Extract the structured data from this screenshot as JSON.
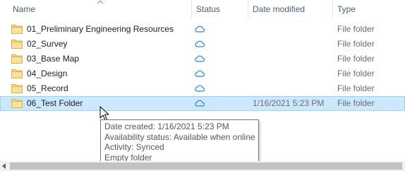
{
  "columns": {
    "name": "Name",
    "status": "Status",
    "date_modified": "Date modified",
    "type": "Type"
  },
  "rows": [
    {
      "name": "01_Preliminary Engineering Resources",
      "date": "",
      "type": "File folder"
    },
    {
      "name": "02_Survey",
      "date": "",
      "type": "File folder"
    },
    {
      "name": "03_Base Map",
      "date": "",
      "type": "File folder"
    },
    {
      "name": "04_Design",
      "date": "",
      "type": "File folder"
    },
    {
      "name": "05_Record",
      "date": "",
      "type": "File folder"
    },
    {
      "name": "06_Test Folder",
      "date": "1/16/2021 5:23 PM",
      "type": "File folder"
    }
  ],
  "tooltip": {
    "line1": "Date created: 1/16/2021 5:23 PM",
    "line2": "Availability status: Available when online",
    "line3": "Activity: Synced",
    "line4": "Empty folder"
  },
  "colors": {
    "folder": "#f8d775",
    "cloud": "#2b88d8",
    "selection": "#cce8ff",
    "header_text": "#4c607a"
  },
  "icons": {
    "folder": "folder-icon",
    "status": "cloud-icon",
    "sort": "sort-ascending-icon",
    "cursor": "mouse-pointer-icon"
  }
}
